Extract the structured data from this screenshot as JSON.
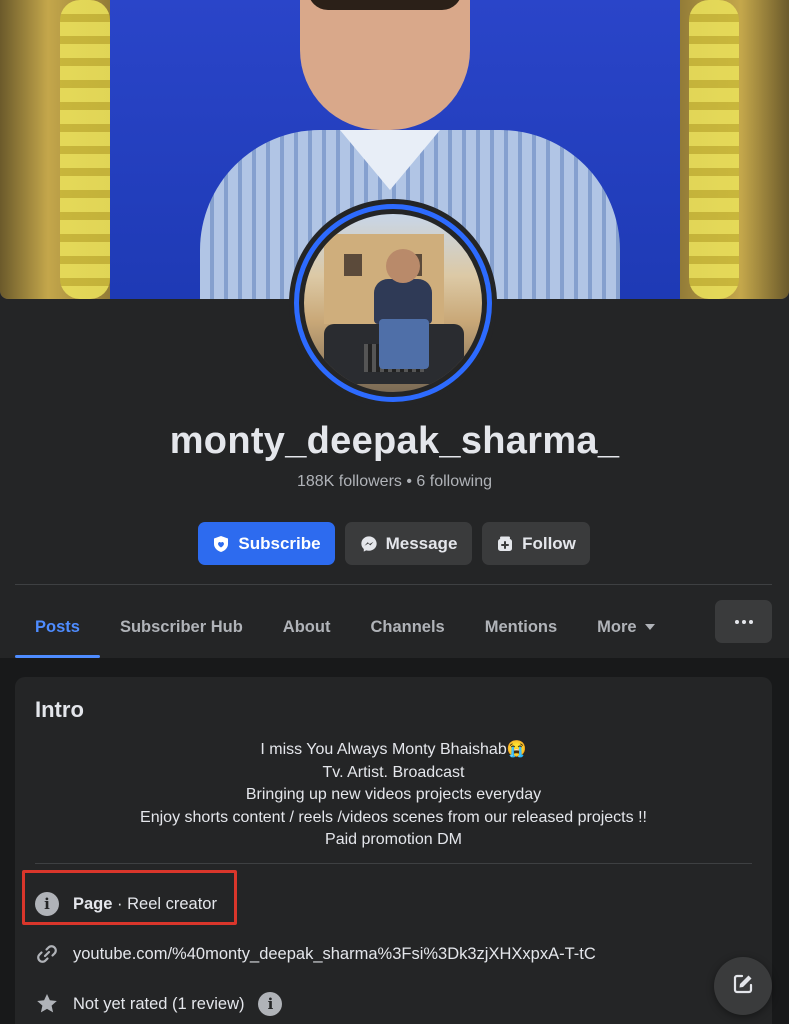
{
  "profile": {
    "name": "monty_deepak_sharma_",
    "followers": "188K followers",
    "separator": "•",
    "following": "6 following"
  },
  "actions": {
    "subscribe": "Subscribe",
    "message": "Message",
    "follow": "Follow"
  },
  "tabs": [
    {
      "label": "Posts",
      "active": true
    },
    {
      "label": "Subscriber Hub"
    },
    {
      "label": "About"
    },
    {
      "label": "Channels"
    },
    {
      "label": "Mentions"
    },
    {
      "label": "More"
    }
  ],
  "intro": {
    "title": "Intro",
    "bio": [
      "I miss You Always Monty Bhaishab😭",
      "Tv. Artist. Broadcast",
      "Bringing up new videos projects everyday",
      "Enjoy shorts content / reels /videos scenes from our released projects !!",
      "Paid promotion DM"
    ],
    "page_label": "Page",
    "page_category": " · Reel creator",
    "link": "youtube.com/%40monty_deepak_sharma%3Fsi%3Dk3zjXHXxpxA-T-tC",
    "rating": "Not yet rated (1 review)"
  },
  "colors": {
    "accent": "#2d6bef",
    "tab_active": "#4e8cff",
    "highlight": "#d9362b",
    "background": "#242526"
  },
  "icons": {
    "subscribe": "shield-heart-icon",
    "message": "messenger-icon",
    "follow": "follow-add-icon",
    "info": "info-icon",
    "link": "link-icon",
    "star": "star-icon",
    "compose": "compose-icon"
  }
}
